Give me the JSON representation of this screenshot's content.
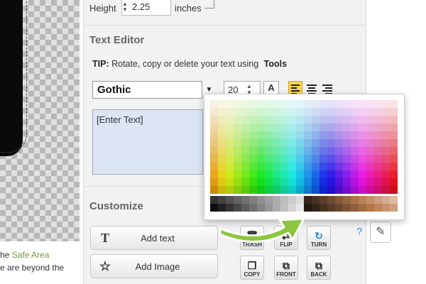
{
  "left": {
    "info_line1_prefix": "he ",
    "info_line1_link": "Safe Area",
    "info_line2": "e are beyond the"
  },
  "dimensions": {
    "height_label": "Height",
    "height_value": "2.25",
    "unit": "inches"
  },
  "text_editor": {
    "title": "Text Editor",
    "tip_label": "TIP:",
    "tip_text": "Rotate, copy or delete your text using",
    "tip_tools": "Tools",
    "font": "Gothic",
    "font_size": "20",
    "color_button_label": "A",
    "text_placeholder": "[Enter Text]"
  },
  "customize": {
    "title": "Customize",
    "add_text_label": "Add text",
    "add_image_label": "Add Image",
    "tools": {
      "trash": "TRASH",
      "flip": "FLIP",
      "turn": "TURN",
      "copy": "COPY",
      "front": "FRONT",
      "back": "BACK"
    },
    "help": "?"
  },
  "colors": {
    "accent_green": "#6aa12a",
    "highlight": "#f7d44a",
    "text_color_bar": "#d0021b",
    "arrow_green": "#8cc63f"
  },
  "icons": [
    "text-icon",
    "star-plus-icon",
    "trash-icon",
    "flip-icon",
    "turn-icon",
    "copy-icon",
    "front-icon",
    "back-icon",
    "eyedropper-icon",
    "chevron-down-icon"
  ]
}
